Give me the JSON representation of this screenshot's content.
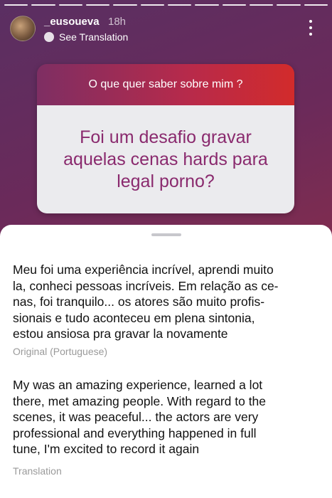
{
  "story": {
    "progress_segments": 12,
    "progress_done": 12,
    "username": "_eusoueva",
    "time": "18h",
    "see_translation": "See Translation"
  },
  "question_sticker": {
    "question": "O que quer saber sobre mim ?",
    "answer": "Foi um desafio gravar aquelas cenas hards para legal porno?"
  },
  "translation_sheet": {
    "original_lines": [
      "Meu foi uma experiência incrível, aprendi muito",
      "la, conheci pessoas incríveis. Em relação as ce-",
      "nas, foi tranquilo... os atores são muito profis-",
      "sionais e tudo aconteceu em plena sintonia,",
      "estou ansiosa pra gravar la novamente"
    ],
    "original_label": "Original (Portuguese)",
    "translation_lines": [
      "My was an amazing experience, learned a lot",
      "there, met amazing people. With regard to the",
      "scenes, it was peaceful... the actors are very",
      "professional and everything happened in full",
      "tune, I'm excited to record it again"
    ],
    "translation_label": "Translation"
  }
}
